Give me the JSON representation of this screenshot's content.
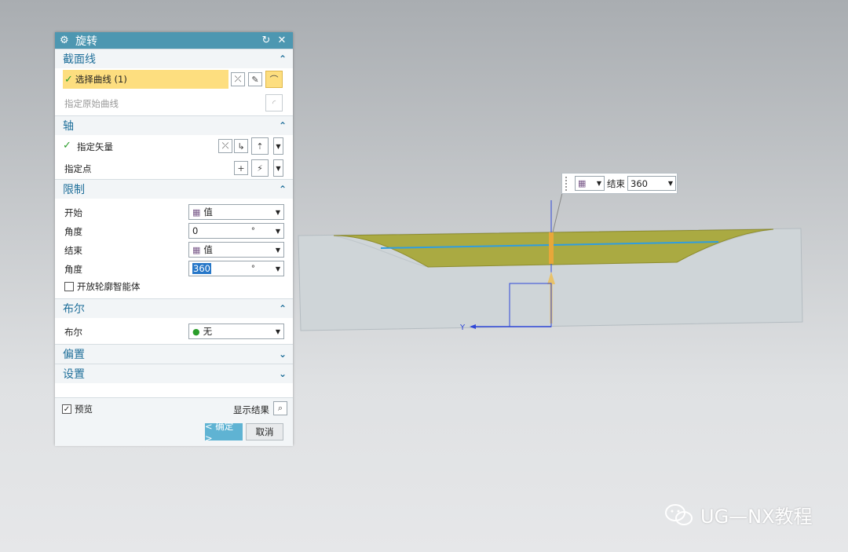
{
  "dialog": {
    "title": "旋转",
    "sections": {
      "section_curve": {
        "title": "截面线",
        "select_curve": "选择曲线 (1)",
        "specify_origin_curve": "指定原始曲线"
      },
      "axis": {
        "title": "轴",
        "specify_vector": "指定矢量",
        "specify_point": "指定点"
      },
      "limits": {
        "title": "限制",
        "start_label": "开始",
        "start_value": "值",
        "start_angle_label": "角度",
        "start_angle": "0",
        "end_label": "结束",
        "end_value": "值",
        "end_angle_label": "角度",
        "end_angle": "360",
        "unit": "°",
        "open_profile": "开放轮廓智能体"
      },
      "boolean": {
        "title": "布尔",
        "label": "布尔",
        "value": "无"
      },
      "offset": {
        "title": "偏置"
      },
      "settings": {
        "title": "设置"
      }
    },
    "preview_label": "预览",
    "show_result_label": "显示结果",
    "ok_label": "< 确定 >",
    "cancel_label": "取消"
  },
  "floating_bar": {
    "end_label": "结束",
    "end_value": "360"
  },
  "viewport": {
    "axis_y_label": "Y"
  },
  "watermark": {
    "text": "UG—NX教程"
  },
  "colors": {
    "title_bar": "#4d97b1",
    "section_text": "#1f6f9a",
    "highlight": "#fdde7f",
    "solid": "#cfd5d8",
    "surface": "#a9a83a",
    "axis": "#2f47d8"
  }
}
